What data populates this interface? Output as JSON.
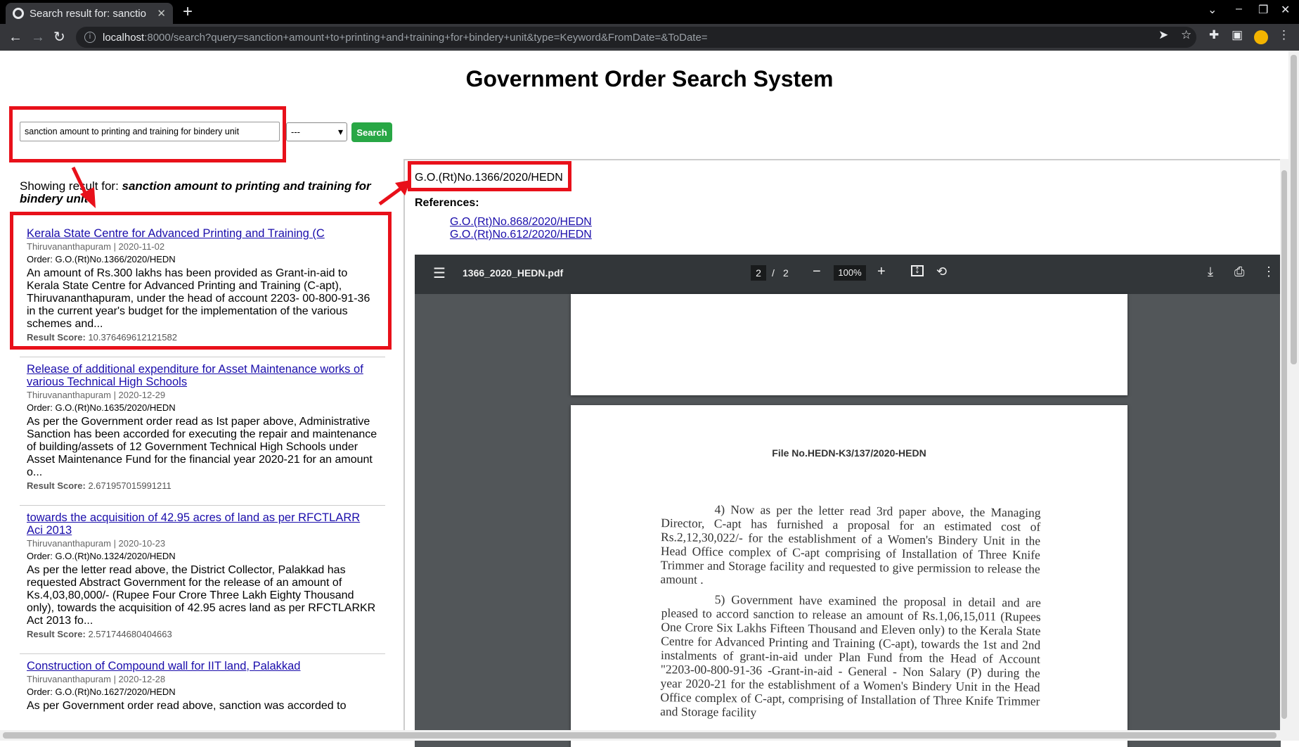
{
  "browser": {
    "tab_title": "Search result for: sanctio",
    "url_host": "localhost",
    "url_rest": ":8000/search?query=sanction+amount+to+printing+and+training+for+bindery+unit&type=Keyword&FromDate=&ToDate="
  },
  "page": {
    "title": "Government Order Search System"
  },
  "search": {
    "query_value": "sanction amount to printing and training for bindery unit",
    "type_selected": "---",
    "button_label": "Search"
  },
  "showing": {
    "prefix": "Showing result for: ",
    "query": "sanction amount to printing and training for bindery unit"
  },
  "results": [
    {
      "title": "Kerala State Centre for Advanced Printing and Training (C",
      "meta": "Thiruvananthapuram | 2020-11-02",
      "order": "Order: G.O.(Rt)No.1366/2020/HEDN",
      "description": "An amount of Rs.300 lakhs has been provided as Grant-in-aid to Kerala State Centre for Advanced Printing and Training (C-apt), Thiruvananthapuram, under the head of account 2203- 00-800-91-36 in the current year's budget for the implementation of the various schemes and...",
      "score_label": "Result Score:",
      "score": "10.376469612121582"
    },
    {
      "title": "Release of additional expenditure for Asset Maintenance works of various Technical High Schools",
      "meta": "Thiruvananthapuram | 2020-12-29",
      "order": "Order: G.O.(Rt)No.1635/2020/HEDN",
      "description": "As per the Government order read as Ist paper above, Administrative Sanction has been accorded for executing the repair and maintenance of building/assets of 12 Government Technical High Schools under Asset Maintenance Fund for the financial year 2020-21 for an amount o...",
      "score_label": "Result Score:",
      "score": "2.671957015991211"
    },
    {
      "title": "towards the acquisition of 42.95 acres of land as per RFCTLARR Aci 2013",
      "meta": "Thiruvananthapuram | 2020-10-23",
      "order": "Order: G.O.(Rt)No.1324/2020/HEDN",
      "description": "As per the letter read above, the District Collector, Palakkad has requested Abstract Government for the release of an amount of Ks.4,03,80,000/- (Rupee Four Crore Three Lakh Eighty Thousand only), towards the acquisition of 42.95 acres land as per RFCTLARKR Act 2013 fo...",
      "score_label": "Result Score:",
      "score": "2.571744680404663"
    },
    {
      "title": "Construction of Compound wall for IIT land, Palakkad",
      "meta": "Thiruvananthapuram | 2020-12-28",
      "order": "Order: G.O.(Rt)No.1627/2020/HEDN",
      "description": "As per Government order read above, sanction was accorded to",
      "score_label": "",
      "score": ""
    }
  ],
  "detail": {
    "go_number": "G.O.(Rt)No.1366/2020/HEDN",
    "references_label": "References:",
    "references": [
      "G.O.(Rt)No.868/2020/HEDN",
      "G.O.(Rt)No.612/2020/HEDN"
    ]
  },
  "pdf": {
    "filename": "1366_2020_HEDN.pdf",
    "current_page": "2",
    "page_separator": "/",
    "total_pages": "2",
    "zoom": "100%",
    "file_no": "File No.HEDN-K3/137/2020-HEDN",
    "para4": "4) Now as per the letter read 3rd paper above, the Managing Director, C-apt has furnished a proposal for an estimated cost of Rs.2,12,30,022/- for the establishment of a Women's Bindery Unit in the Head Office complex of C-apt comprising of Installation of Three Knife Trimmer and Storage facility and requested to give permission to release the amount .",
    "para5": "5) Government have examined the proposal in detail and are pleased to accord sanction to release an amount of Rs.1,06,15,011 (Rupees One Crore Six Lakhs Fifteen Thousand and Eleven only) to the Kerala State Centre for Advanced Printing and Training (C-apt), towards the 1st and 2nd instalments of grant-in-aid under Plan Fund from the Head of Account \"2203-00-800-91-36 -Grant-in-aid - General - Non Salary (P) during the year 2020-21 for the establishment of a Women's Bindery Unit in the Head Office complex of C-apt, comprising of Installation of Three Knife Trimmer and Storage facility"
  },
  "colors": {
    "annotation_red": "#e8101a",
    "link": "#1a0dab",
    "search_button": "#28a745"
  }
}
